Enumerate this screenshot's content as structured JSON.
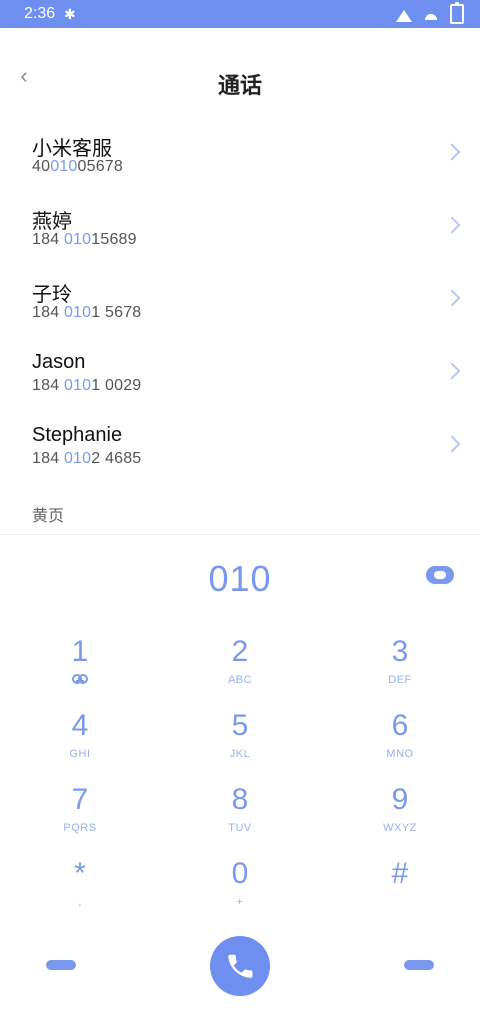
{
  "status": {
    "time": "2:36",
    "bluetooth_glyph": "✱"
  },
  "header": {
    "back_glyph": "‹",
    "title": "通话"
  },
  "contacts": [
    {
      "name": "小米客服",
      "phone_pre": "40",
      "phone_hl": "010",
      "phone_post": "05678"
    },
    {
      "name": "燕婷",
      "phone_pre": "184 ",
      "phone_hl": "010",
      "phone_post": "15689"
    },
    {
      "name": "子玲",
      "phone_pre": "184 ",
      "phone_hl": "010",
      "phone_post": "1 5678"
    },
    {
      "name": "Jason",
      "phone_pre": "184 ",
      "phone_hl": "010",
      "phone_post": "1 0029"
    },
    {
      "name": "Stephanie",
      "phone_pre": "184 ",
      "phone_hl": "010",
      "phone_post": "2 4685"
    }
  ],
  "section": {
    "label": "黄页"
  },
  "dialer": {
    "input": "010"
  },
  "keypad": {
    "keys": [
      {
        "digit": "1",
        "letters": ""
      },
      {
        "digit": "2",
        "letters": "ABC"
      },
      {
        "digit": "3",
        "letters": "DEF"
      },
      {
        "digit": "4",
        "letters": "GHI"
      },
      {
        "digit": "5",
        "letters": "JKL"
      },
      {
        "digit": "6",
        "letters": "MNO"
      },
      {
        "digit": "7",
        "letters": "PQRS"
      },
      {
        "digit": "8",
        "letters": "TUV"
      },
      {
        "digit": "9",
        "letters": "WXYZ"
      },
      {
        "digit": "*",
        "letters": ","
      },
      {
        "digit": "0",
        "letters": "+"
      },
      {
        "digit": "#",
        "letters": ""
      }
    ]
  },
  "colors": {
    "accent": "#7A99EE",
    "accent_strong": "#6E8FF0"
  }
}
